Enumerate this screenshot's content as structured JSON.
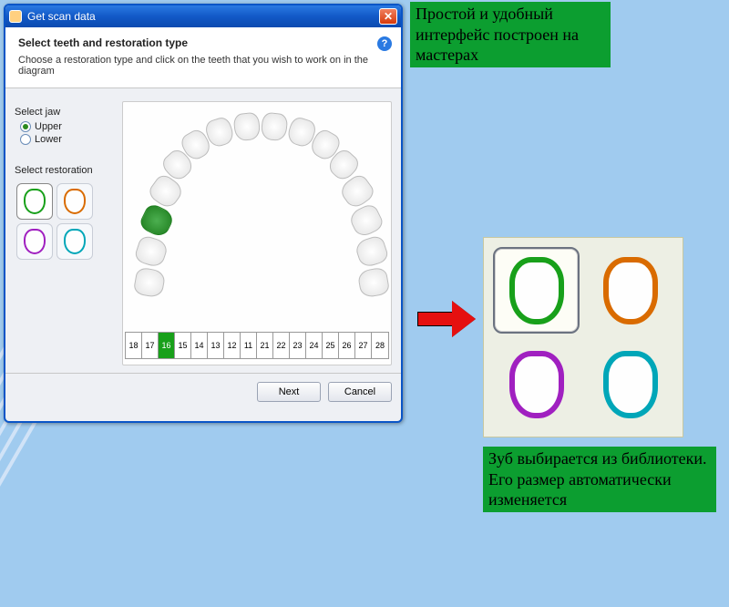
{
  "dialog": {
    "title": "Get scan data",
    "heading": "Select teeth and restoration type",
    "subheading": "Choose a restoration type and click on the teeth that you wish to work on in the diagram",
    "help_tooltip": "?"
  },
  "jaw": {
    "group_label": "Select jaw",
    "options": [
      {
        "label": "Upper",
        "checked": true
      },
      {
        "label": "Lower",
        "checked": false
      }
    ]
  },
  "restoration": {
    "group_label": "Select restoration",
    "options": [
      {
        "id": "green",
        "color": "#18a01a",
        "selected": true
      },
      {
        "id": "orange",
        "color": "#d96b00",
        "selected": false
      },
      {
        "id": "purple",
        "color": "#a020c0",
        "selected": false
      },
      {
        "id": "cyan",
        "color": "#00a6b8",
        "selected": false
      }
    ]
  },
  "teeth": {
    "numbers": [
      "18",
      "17",
      "16",
      "15",
      "14",
      "13",
      "12",
      "11",
      "21",
      "22",
      "23",
      "24",
      "25",
      "26",
      "27",
      "28"
    ],
    "selected": "16"
  },
  "buttons": {
    "next": "Next",
    "cancel": "Cancel"
  },
  "captions": {
    "top": "Простой и удобный интерфейс построен на мастерах",
    "bottom": "Зуб выбирается из библиотеки. Его размер автоматически изменяется"
  },
  "big_palette": {
    "options": [
      "green",
      "orange",
      "purple",
      "cyan"
    ],
    "selected": "green"
  }
}
